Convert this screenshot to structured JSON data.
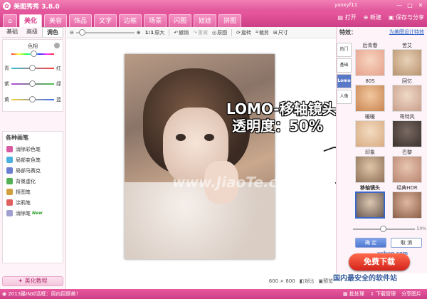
{
  "app": {
    "title": "美图秀秀 3.8.0",
    "user": "yaoxyf11"
  },
  "tabs": [
    "美化",
    "美容",
    "饰品",
    "文字",
    "边框",
    "场景",
    "闪图",
    "娃娃",
    "拼图"
  ],
  "active_tab": "美化",
  "top_actions": {
    "open": "打开",
    "new": "新建",
    "save": "保存与分享"
  },
  "left": {
    "subtabs": [
      "基础",
      "高级",
      "调色"
    ],
    "active_subtab": "调色",
    "hue_label": "色相",
    "sliders": [
      {
        "left": "青",
        "right": "红",
        "value": 0.5,
        "colors": [
          "#35c3d6",
          "#ff3b3b"
        ]
      },
      {
        "left": "紫",
        "right": "绿",
        "value": 0.5,
        "colors": [
          "#b04bd6",
          "#4bc44b"
        ]
      },
      {
        "left": "黄",
        "right": "蓝",
        "value": 0.5,
        "colors": [
          "#f4d03b",
          "#3b6cf4"
        ]
      }
    ],
    "brush_header": "各种画笔",
    "brushes": [
      {
        "label": "消除彩色笔",
        "color": "#d85aa0",
        "new": ""
      },
      {
        "label": "局部变色笔",
        "color": "#4bb0e0",
        "new": ""
      },
      {
        "label": "局部马赛克",
        "color": "#6a7fd0",
        "new": ""
      },
      {
        "label": "背景虚化",
        "color": "#55b055",
        "new": ""
      },
      {
        "label": "抠图笔",
        "color": "#d0a040",
        "new": ""
      },
      {
        "label": "涂鸦笔",
        "color": "#e06060",
        "new": ""
      },
      {
        "label": "消除笔",
        "color": "#a0a0d0",
        "new": "New"
      }
    ],
    "tutorial": "美化教程"
  },
  "toolbar": {
    "ratio": "1:1",
    "original": "原大",
    "undo": "撤销",
    "redo": "重做",
    "restore": "原图",
    "rotate": "旋转",
    "crop": "裁剪",
    "size": "尺寸"
  },
  "canvas": {
    "overlay_line1": "LOMO-移轴镜头",
    "overlay_line2": "透明度：50%",
    "watermark": "www.JiaoTe.com",
    "dims": "600 × 800",
    "compare": "对比",
    "preview": "预览"
  },
  "right": {
    "title": "特效：",
    "link": "为美图设计特效",
    "vtabs": [
      "热门",
      "基础",
      "Lomo",
      "人像"
    ],
    "active_vtab": "Lomo",
    "effects": [
      {
        "label": "后青春",
        "colors": [
          "#f7d5c0",
          "#e6a08a"
        ]
      },
      {
        "label": "苦艾",
        "colors": [
          "#e8d2b8",
          "#b8926e"
        ]
      },
      {
        "label": "80S",
        "colors": [
          "#f2c8a0",
          "#c88450"
        ]
      },
      {
        "label": "回忆",
        "colors": [
          "#f0d9c8",
          "#c89e8a"
        ]
      },
      {
        "label": "暖暖",
        "colors": [
          "#f3dcc0",
          "#d8aa82"
        ]
      },
      {
        "label": "哥特风",
        "colors": [
          "#7a6a62",
          "#3a302c"
        ]
      },
      {
        "label": "印象",
        "colors": [
          "#e0c6a8",
          "#8e7058"
        ]
      },
      {
        "label": "巴黎",
        "colors": [
          "#e8c6b0",
          "#b88470"
        ]
      },
      {
        "label": "移轴镜头",
        "colors": [
          "#dcc6b0",
          "#6a5a52"
        ]
      },
      {
        "label": "经典HDR",
        "colors": [
          "#e0b8a0",
          "#8a5e48"
        ]
      }
    ],
    "selected_effect": "移轴镜头",
    "opacity_value": "50%",
    "opacity_fraction": 0.5,
    "ok": "确 定",
    "cancel": "取 消"
  },
  "ad": {
    "button": "免费下载",
    "brand": "ucbug.com",
    "footer": "国内最安全的软件站"
  },
  "bottom": {
    "news": "2013最IN对话框：周向回顾美！",
    "batch": "批处理",
    "download": "下载管理",
    "share": "分享图片"
  },
  "colors": {
    "brand": "#e0559a",
    "accent": "#3b68c6"
  }
}
